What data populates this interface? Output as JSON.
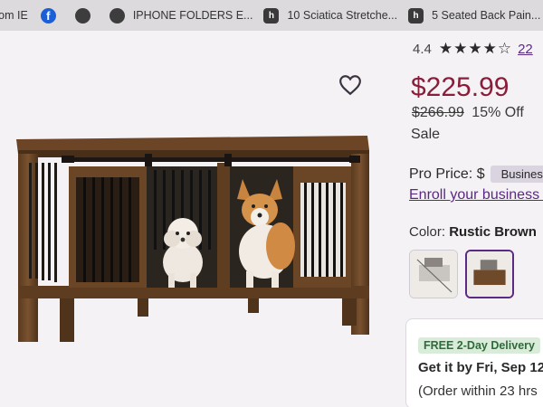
{
  "bookmarks": [
    {
      "label": "rom IE",
      "icon": "none"
    },
    {
      "label": "",
      "icon": "facebook-icon"
    },
    {
      "label": "",
      "icon": "globe-icon"
    },
    {
      "label": "IPHONE FOLDERS E...",
      "icon": "globe-icon"
    },
    {
      "label": "10 Sciatica Stretche...",
      "icon": "h-site-icon"
    },
    {
      "label": "5 Seated Back Pain...",
      "icon": "h-site-icon"
    }
  ],
  "product": {
    "rating_value": "4.4",
    "rating_stars": "★★★★☆",
    "rating_count": "22",
    "price": "$225.99",
    "was_price": "$266.99",
    "discount": "15% Off",
    "sale_label": "Sale",
    "pro_price_label": "Pro Price: $",
    "pro_badge": "Business",
    "enroll_link": "Enroll your business f",
    "color_label": "Color:",
    "color_value": "Rustic Brown",
    "swatches": [
      {
        "name": "swatch-white-gray",
        "selected": false
      },
      {
        "name": "swatch-rustic-brown",
        "selected": true
      }
    ]
  },
  "delivery": {
    "badge": "FREE 2-Day Delivery",
    "get_it": "Get it by Fri, Sep 12",
    "order_within": "(Order within 23 hrs"
  },
  "colors": {
    "price": "#8a1d3a",
    "accent_purple": "#5a2a82",
    "delivery_green": "#2f6a3b"
  }
}
